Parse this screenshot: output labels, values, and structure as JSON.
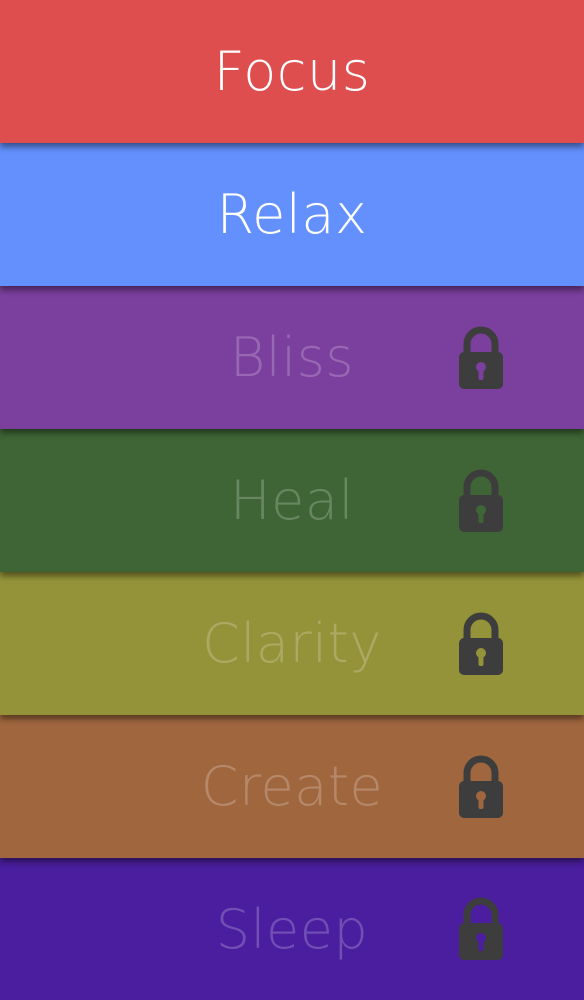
{
  "items": [
    {
      "label": "Focus",
      "color": "#de4e4e",
      "locked": false
    },
    {
      "label": "Relax",
      "color": "#6390fc",
      "locked": false
    },
    {
      "label": "Bliss",
      "color": "#7b3f9d",
      "locked": true,
      "icon": "lock-icon"
    },
    {
      "label": "Heal",
      "color": "#3f6536",
      "locked": true,
      "icon": "lock-icon"
    },
    {
      "label": "Clarity",
      "color": "#949339",
      "locked": true,
      "icon": "lock-icon"
    },
    {
      "label": "Create",
      "color": "#a0673f",
      "locked": true,
      "icon": "lock-icon"
    },
    {
      "label": "Sleep",
      "color": "#4b1e9f",
      "locked": true,
      "icon": "lock-icon"
    }
  ],
  "lock_color": "#3d3d3d"
}
